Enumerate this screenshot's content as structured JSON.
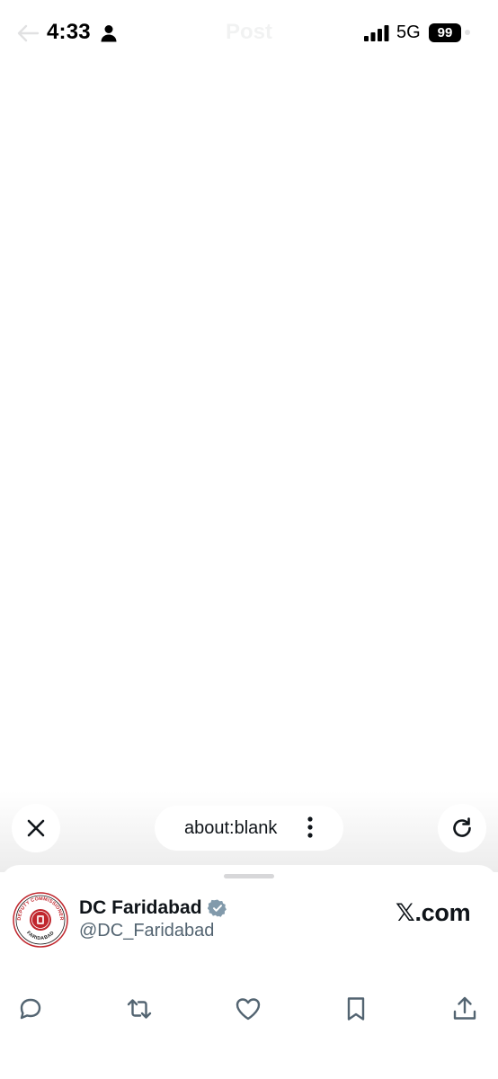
{
  "status_bar": {
    "time": "4:33",
    "network": "5G",
    "battery": "99",
    "ghost_title": "Post"
  },
  "browser": {
    "url": "about:blank",
    "icons": [
      "close-icon",
      "more-vertical-icon",
      "reload-icon"
    ]
  },
  "sheet": {
    "account_name": "DC Faridabad",
    "handle": "@DC_Faridabad",
    "site": "𝕏.com",
    "avatar_text_top": "DEPUTY COMMISSIONER",
    "avatar_text_bottom": "FARIDABAD",
    "actions": [
      "reply-icon",
      "repost-icon",
      "like-icon",
      "bookmark-icon",
      "share-icon"
    ]
  },
  "colors": {
    "text": "#0f1419",
    "secondary": "#536471",
    "verified": "#829aab",
    "toolbar_bg": "#ececec",
    "seal_red": "#c0262d"
  }
}
